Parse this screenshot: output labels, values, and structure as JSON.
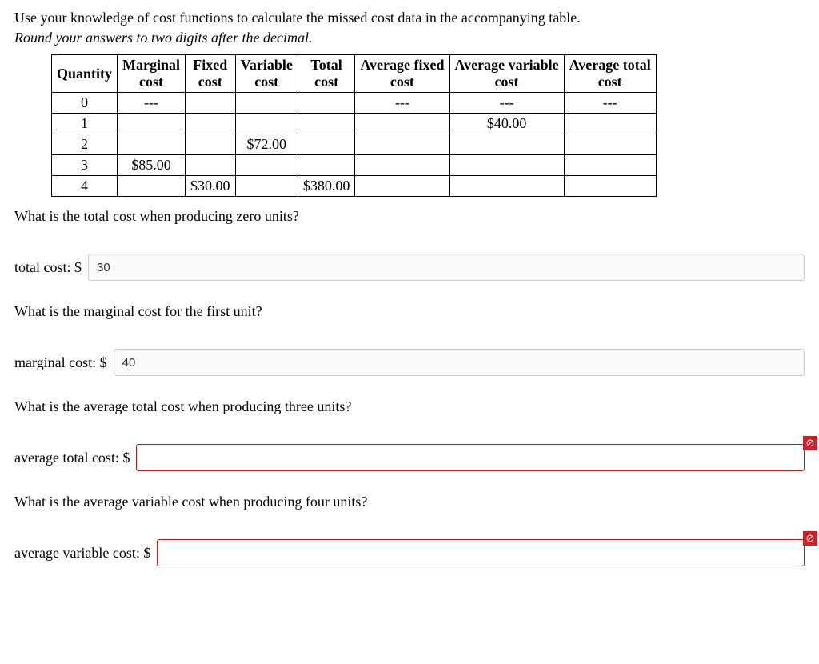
{
  "intro": "Use your knowledge of cost functions to calculate the missed cost data in the accompanying table.",
  "subintro": "Round your answers to two digits after the decimal.",
  "headers": {
    "quantity": "Quantity",
    "mc": "Marginal cost",
    "fc": "Fixed cost",
    "vc": "Variable cost",
    "tc": "Total cost",
    "afc": "Average fixed cost",
    "avc": "Average variable cost",
    "atc": "Average total cost"
  },
  "rows": [
    {
      "q": "0",
      "mc": "---",
      "fc": "",
      "vc": "",
      "tc": "",
      "afc": "---",
      "avc": "---",
      "atc": "---"
    },
    {
      "q": "1",
      "mc": "",
      "fc": "",
      "vc": "",
      "tc": "",
      "afc": "",
      "avc": "$40.00",
      "atc": ""
    },
    {
      "q": "2",
      "mc": "",
      "fc": "",
      "vc": "$72.00",
      "tc": "",
      "afc": "",
      "avc": "",
      "atc": ""
    },
    {
      "q": "3",
      "mc": "$85.00",
      "fc": "",
      "vc": "",
      "tc": "",
      "afc": "",
      "avc": "",
      "atc": ""
    },
    {
      "q": "4",
      "mc": "",
      "fc": "$30.00",
      "vc": "",
      "tc": "$380.00",
      "afc": "",
      "avc": "",
      "atc": ""
    }
  ],
  "q1": "What is the total cost when producing zero units?",
  "q1label": "total cost: $",
  "q1value": "30",
  "q2": "What is the marginal cost for the first unit?",
  "q2label": "marginal cost: $",
  "q2value": "40",
  "q3": "What is the average total cost when producing three units?",
  "q3label": "average total cost: $",
  "q3value": "",
  "q4": "What is the average variable cost when producing four units?",
  "q4label": "average variable cost: $",
  "q4value": "",
  "errorGlyph": "⊘"
}
